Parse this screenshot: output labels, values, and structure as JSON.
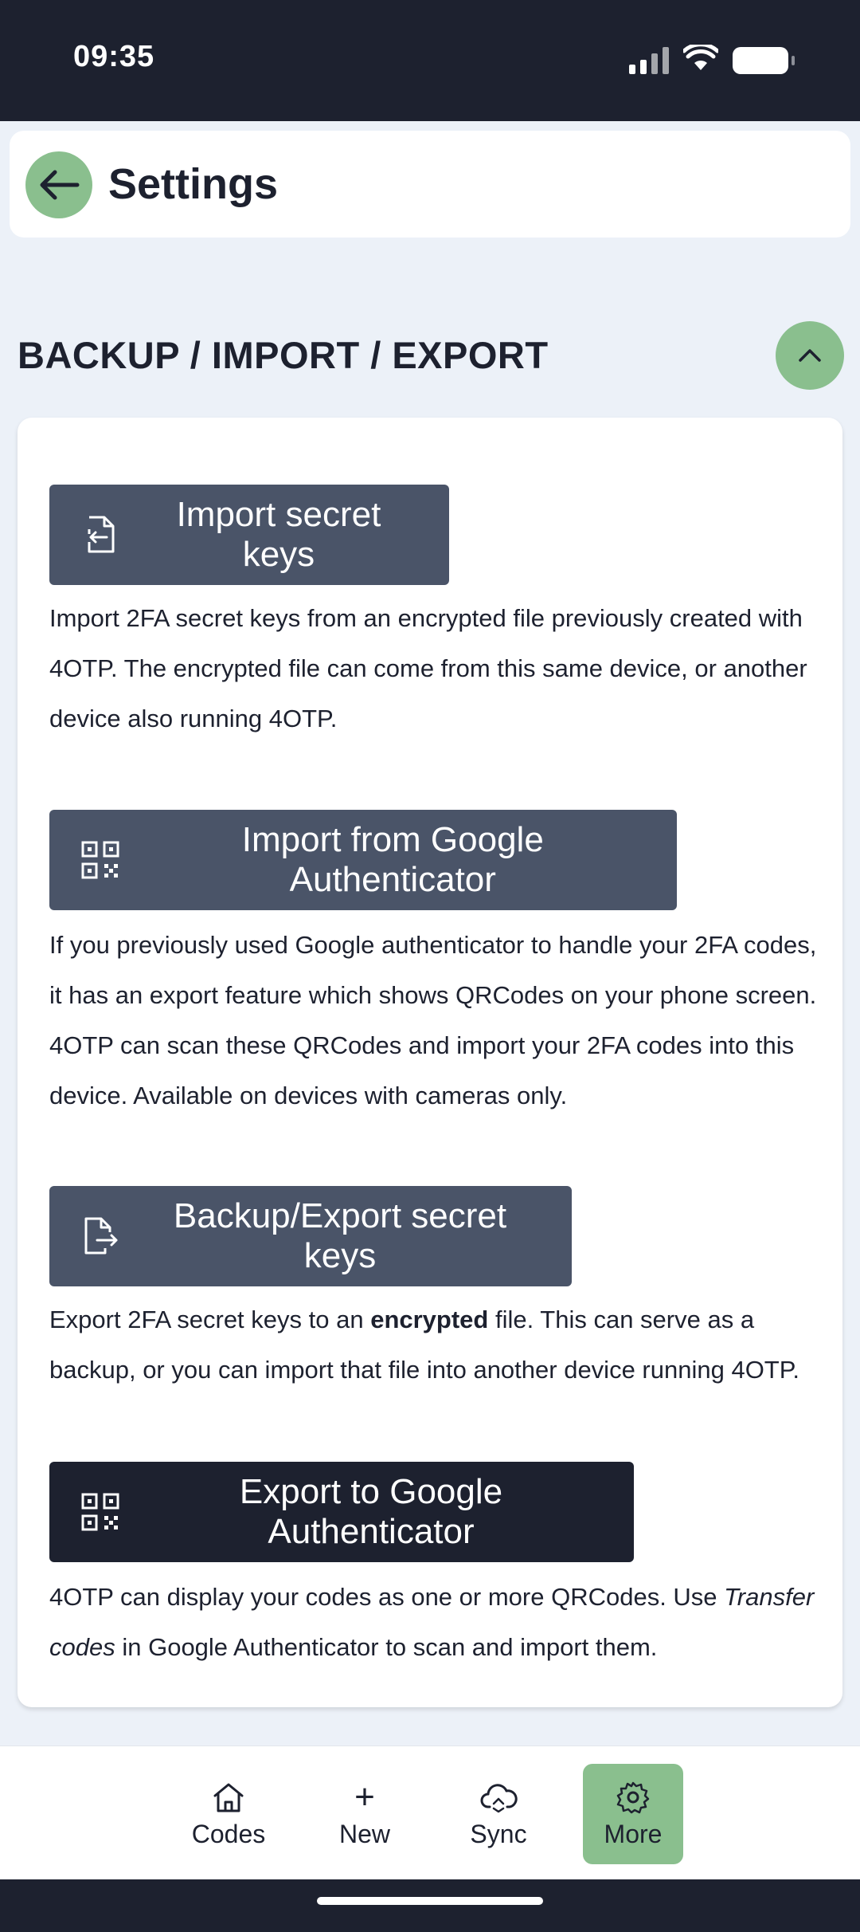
{
  "status_bar": {
    "time": "09:35"
  },
  "header": {
    "title": "Settings"
  },
  "section": {
    "title": "BACKUP / IMPORT / EXPORT"
  },
  "actions": [
    {
      "label": "Import secret keys",
      "icon": "file-import-icon",
      "description": "Import 2FA secret keys from an encrypted file previously created with 4OTP. The encrypted file can come from this same device, or another device also running 4OTP."
    },
    {
      "label": "Import from Google Authenticator",
      "icon": "qrcode-icon",
      "description": "If you previously used Google authenticator to handle your 2FA codes, it has an export feature which shows QRCodes on your phone screen. 4OTP can scan these QRCodes and import your 2FA codes into this device. Available on devices with cameras only."
    },
    {
      "label": "Backup/Export secret keys",
      "icon": "file-export-icon",
      "description_before": "Export 2FA secret keys to an ",
      "description_bold": "encrypted",
      "description_after": " file. This can serve as a backup, or you can import that file into another device running 4OTP."
    },
    {
      "label": "Export to Google Authenticator",
      "icon": "qrcode-icon",
      "description_before": "4OTP can display your codes as one or more QRCodes. Use ",
      "description_italic": "Transfer codes",
      "description_after": " in Google Authenticator to scan and import them."
    }
  ],
  "nav": {
    "items": [
      {
        "label": "Codes",
        "icon": "home-icon"
      },
      {
        "label": "New",
        "icon": "plus-icon",
        "glyph": "+"
      },
      {
        "label": "Sync",
        "icon": "cloud-sync-icon"
      },
      {
        "label": "More",
        "icon": "gear-icon",
        "active": true
      }
    ]
  },
  "colors": {
    "accent_green": "#8abf8e",
    "button_slate": "#4a5468",
    "button_dark": "#1d212f",
    "background": "#ecf1f8"
  }
}
